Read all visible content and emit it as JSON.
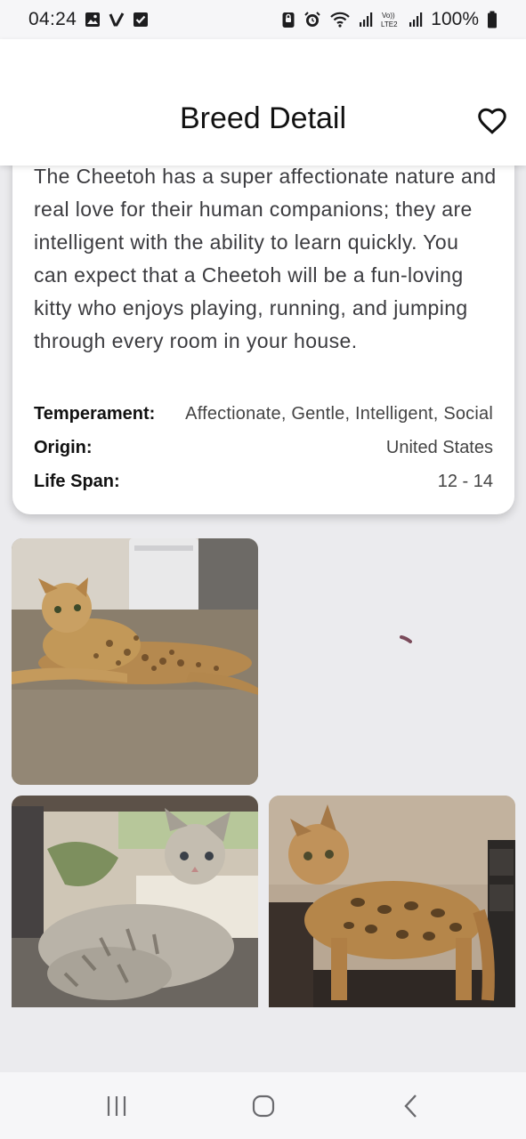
{
  "status_bar": {
    "time": "04:24",
    "battery": "100%",
    "icons": [
      "image-icon",
      "v-icon",
      "checkbox-icon",
      "lock-icon",
      "alarm-icon",
      "wifi-icon",
      "signal-icon",
      "volte-icon",
      "signal-icon",
      "battery-icon"
    ],
    "volte_text": "Vo)) LTE2"
  },
  "app_bar": {
    "title": "Breed Detail",
    "favorite_icon": "heart-outline-icon"
  },
  "breed": {
    "description": "The Cheetoh has a super affectionate nature and real love for their human companions; they are intelligent with the ability to learn quickly. You can expect that a Cheetoh will be a fun-loving kitty who enjoys playing, running, and jumping through every room in your house.",
    "temperament_label": "Temperament:",
    "temperament_value": "Affectionate, Gentle, Intelligent, Social",
    "origin_label": "Origin:",
    "origin_value": "United States",
    "life_span_label": "Life Span:",
    "life_span_value": "12 - 14"
  },
  "gallery": {
    "photos": [
      "cheetoh-cat-photo-1",
      "loading",
      "cheetoh-cat-photo-3",
      "cheetoh-cat-photo-4"
    ]
  },
  "nav_bar": {
    "icons": [
      "recent-apps-icon",
      "home-icon",
      "back-icon"
    ]
  },
  "colors": {
    "background": "#ebebee",
    "surface": "#ffffff",
    "loader": "#7a4a5a"
  }
}
